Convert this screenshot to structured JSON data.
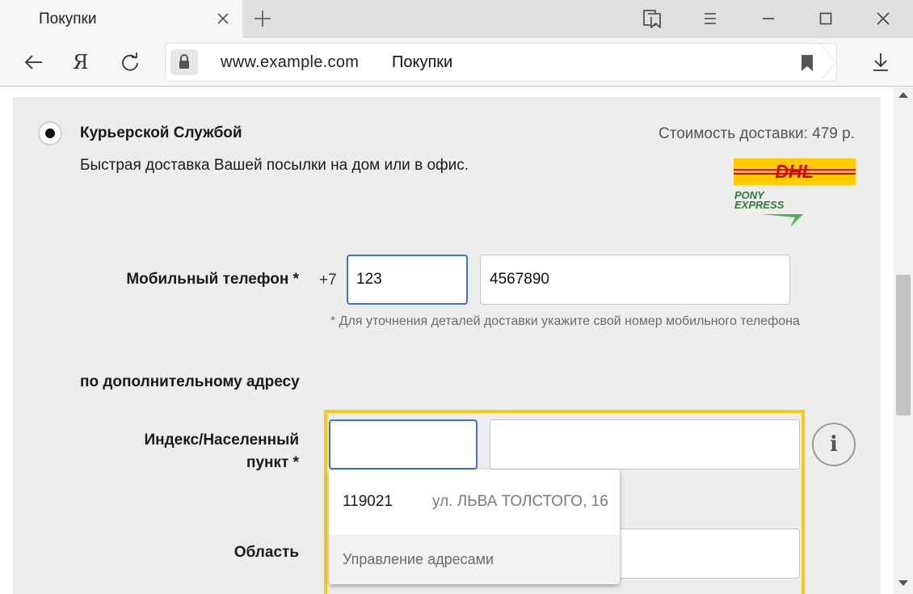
{
  "browser": {
    "tab_title": "Покупки",
    "url": "www.example.com",
    "page_title": "Покупки",
    "logo_letter": "Я"
  },
  "delivery": {
    "option_title": "Курьерской Службой",
    "description": "Быстрая доставка Вашей посылки на дом или в офис.",
    "cost": "Стоимость доставки: 479 р.",
    "carrier_logos": [
      "DHL",
      "PONY EXPRESS"
    ]
  },
  "form": {
    "phone_label": "Мобильный телефон *",
    "phone_prefix": "+7",
    "phone_code": "123",
    "phone_number": "4567890",
    "phone_hint": "* Для уточнения деталей доставки укажите свой номер мобильного телефона",
    "extra_address_heading": "по дополнительному адресу",
    "locality_label_line1": "Индекс/Населенный",
    "locality_label_line2": "пункт *",
    "index_value": "",
    "locality_value": "",
    "region_label": "Область",
    "info_icon_text": "i"
  },
  "autocomplete": {
    "suggestion_index": "119021",
    "suggestion_address": "ул. ЛЬВА ТОЛСТОГО, 16",
    "manage_label": "Управление адресами"
  },
  "colors": {
    "highlight_frame": "#f6c915",
    "focus_border": "#3d74c7",
    "dhl_yellow": "#ffcc00",
    "dhl_red": "#d40511",
    "pony_green": "#4caf50"
  }
}
